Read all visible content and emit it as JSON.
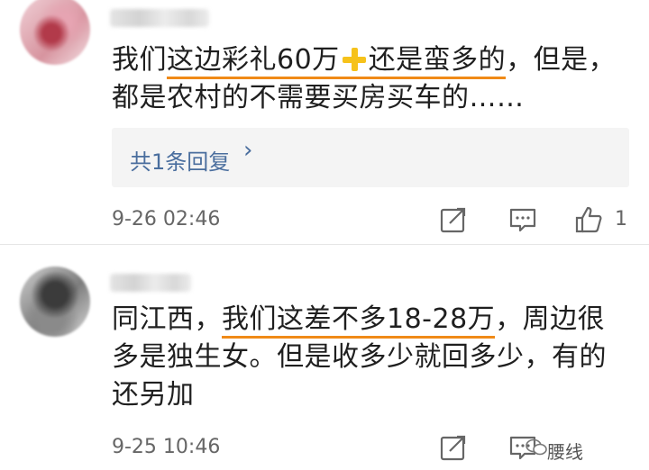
{
  "comments": [
    {
      "text_before_underline": "我们",
      "underlined": "这边彩礼60万",
      "plus_icon": "plus-icon",
      "underlined_after_plus": "还是蛮多的",
      "text_after": "，但是，都是农村的不需要买房买车的……",
      "replies_label": "共1条回复",
      "time": "9-26 02:46",
      "like_count": "1"
    },
    {
      "text_before_underline": "同江西，",
      "underlined": "我们这差不多18-28万",
      "text_after": "，周边很多是独生女。但是收多少就回多少，有的还另加",
      "time": "9-25 10:46",
      "watermark": "腰线"
    }
  ],
  "colors": {
    "underline": "#f08a17",
    "plus": "#f6c21b",
    "link": "#4a6e9e",
    "meta": "#666666"
  }
}
